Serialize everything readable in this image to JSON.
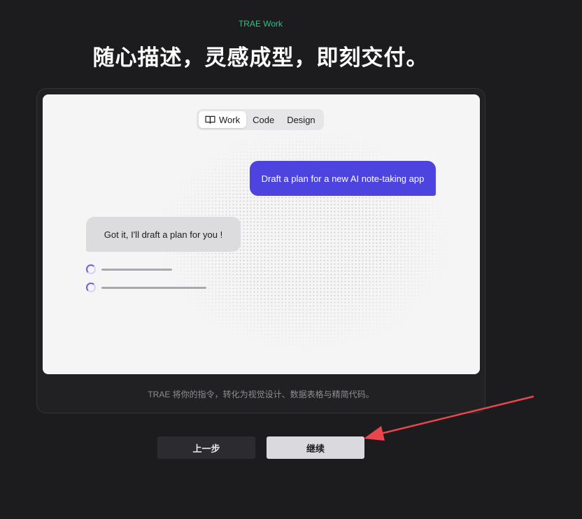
{
  "header": {
    "eyebrow": "TRAE Work",
    "headline": "随心描述，灵感成型，即刻交付。"
  },
  "preview": {
    "modes": [
      {
        "label": "Work",
        "active": true,
        "icon": "book-open-icon"
      },
      {
        "label": "Code",
        "active": false
      },
      {
        "label": "Design",
        "active": false
      }
    ],
    "user_message": "Draft a plan for a new AI note-taking app",
    "ai_message": "Got it,  I'll draft a plan for you !",
    "tasks": [
      {
        "icon": "loading-spinner-icon",
        "progress": 0.67
      },
      {
        "icon": "loading-spinner-icon",
        "progress": 1.0
      }
    ],
    "colors": {
      "user_bubble": "#4d44e0",
      "ai_bubble": "#dcdcde",
      "accent_green": "#2ec27e"
    }
  },
  "caption": "TRAE 将你的指令，转化为视觉设计、数据表格与精简代码。",
  "buttons": {
    "back_label": "上一步",
    "next_label": "继续"
  },
  "annotation": {
    "icon": "red-arrow-annotation",
    "color": "#e8454d"
  }
}
